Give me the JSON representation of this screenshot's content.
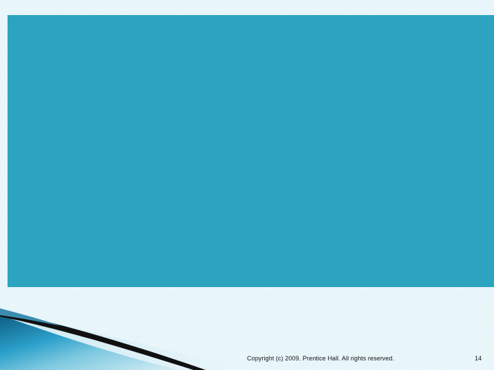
{
  "slide": {
    "footer": {
      "copyright": "Copyright (c) 2009. Prentice Hall. All rights reserved.",
      "page_number": "14"
    },
    "colors": {
      "background": "#e3f4f9",
      "content_panel": "#2ca3bf",
      "swoosh_dark": "#1a1a1a",
      "swoosh_blue": "#1f7fa6",
      "swoosh_light": "#bfe4ef"
    }
  }
}
